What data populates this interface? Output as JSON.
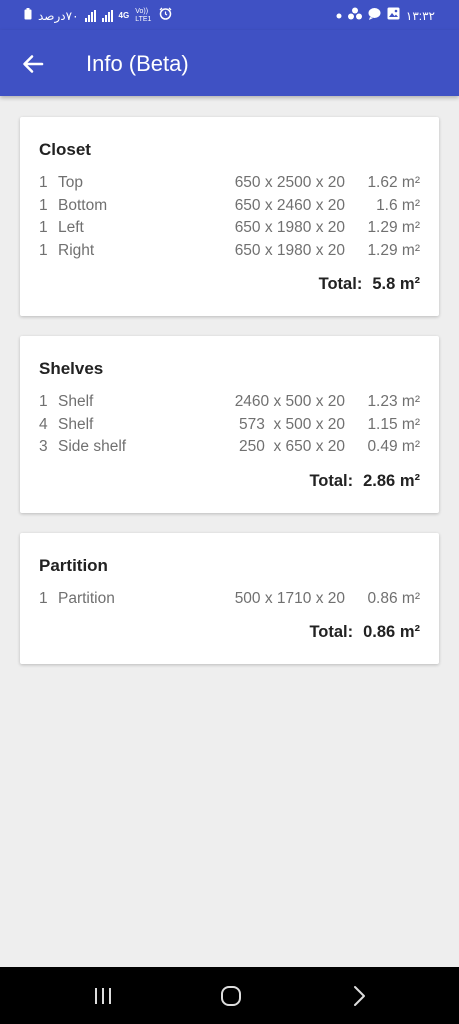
{
  "status_bar": {
    "left_text": "٧٠درصد",
    "network_4g": "4G",
    "volte": "Vo)) LTE1",
    "time": "١٣:٣٢"
  },
  "app_bar": {
    "title": "Info (Beta)",
    "back_icon": "arrow-left-icon"
  },
  "sections": [
    {
      "title": "Closet",
      "rows": [
        {
          "qty": "1",
          "name": "Top",
          "dims": "650 x 2500 x 20",
          "area": "1.62 m²"
        },
        {
          "qty": "1",
          "name": "Bottom",
          "dims": "650 x 2460 x 20",
          "area": "1.6 m²"
        },
        {
          "qty": "1",
          "name": "Left",
          "dims": "650 x 1980 x 20",
          "area": "1.29 m²"
        },
        {
          "qty": "1",
          "name": "Right",
          "dims": "650 x 1980 x 20",
          "area": "1.29 m²"
        }
      ],
      "total_label": "Total:",
      "total_value": "5.8 m²"
    },
    {
      "title": "Shelves",
      "rows": [
        {
          "qty": "1",
          "name": "Shelf",
          "dims": "2460 x 500 x 20",
          "area": "1.23 m²"
        },
        {
          "qty": "4",
          "name": "Shelf",
          "dims": "573  x 500 x 20",
          "area": "1.15 m²"
        },
        {
          "qty": "3",
          "name": "Side shelf",
          "dims": "250  x 650 x 20",
          "area": "0.49 m²"
        }
      ],
      "total_label": "Total:",
      "total_value": "2.86 m²"
    },
    {
      "title": "Partition",
      "rows": [
        {
          "qty": "1",
          "name": "Partition",
          "dims": "500 x 1710 x 20",
          "area": "0.86 m²"
        }
      ],
      "total_label": "Total:",
      "total_value": "0.86 m²"
    }
  ],
  "nav_bar": {
    "recents_icon": "recents-icon",
    "home_icon": "home-icon",
    "back_icon": "chevron-right-icon"
  },
  "colors": {
    "primary": "#3f51c4",
    "background": "#eeeeee",
    "card": "#ffffff",
    "secondary_text": "#707070"
  }
}
